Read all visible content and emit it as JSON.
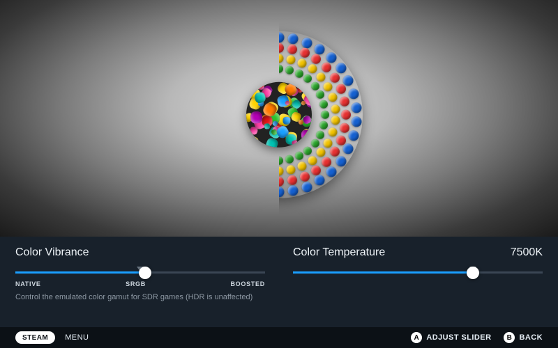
{
  "vibrance": {
    "title": "Color Vibrance",
    "description": "Control the emulated color gamut for SDR games (HDR is unaffected)",
    "labels": {
      "min": "NATIVE",
      "mid": "SRGB",
      "max": "BOOSTED"
    },
    "value_pct": 52,
    "tick_pct": 50
  },
  "temperature": {
    "title": "Color Temperature",
    "value_label": "7500K",
    "value_pct": 72,
    "tick_pct": 72
  },
  "footer": {
    "steam": "STEAM",
    "menu": "MENU",
    "a_glyph": "A",
    "a_label": "ADJUST SLIDER",
    "b_glyph": "B",
    "b_label": "BACK"
  },
  "colors": {
    "accent": "#1a9fff",
    "panel": "#18212b",
    "footer": "#0c1116"
  }
}
